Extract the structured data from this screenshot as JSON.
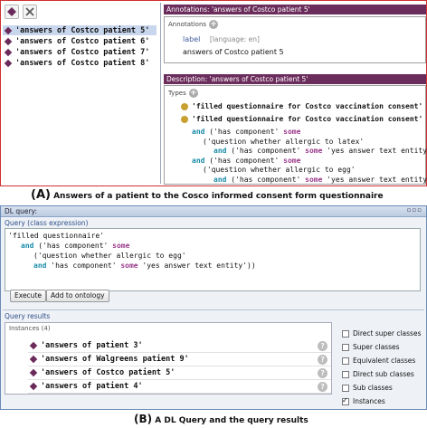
{
  "panel_a": {
    "toolbar": {
      "add_icon": "add-individual-icon",
      "delete_icon": "delete-individual-icon"
    },
    "instances": [
      {
        "label": "'answers of Costco patient 5'",
        "selected": true
      },
      {
        "label": "'answers of Costco patient 6'",
        "selected": false
      },
      {
        "label": "'answers of Costco patient 7'",
        "selected": false
      },
      {
        "label": "'answers of Costco patient 8'",
        "selected": false
      }
    ],
    "annotations": {
      "title": "Annotations: 'answers of Costco patient 5'",
      "header": "Annotations",
      "label_key": "label",
      "language": "[language: en]",
      "label_value": "answers of Costco patient 5"
    },
    "description": {
      "title": "Description: 'answers of Costco patient 5'",
      "types_header": "Types",
      "type1": "'filled questionnaire for Costco vaccination consent'",
      "type2": "'filled questionnaire for Costco vaccination consent'",
      "lines": [
        {
          "and": "and",
          "pre": " ('has component' ",
          "some": "some",
          "post": ""
        },
        {
          "and": "",
          "pre": "('question whether allergic to latex'",
          "some": "",
          "post": ""
        },
        {
          "and": "and",
          "pre": " ('has component' ",
          "some": "some",
          "post": " 'yes answer text entity')))"
        },
        {
          "and": "and",
          "pre": " ('has component' ",
          "some": "some",
          "post": ""
        },
        {
          "and": "",
          "pre": "('question whether allergic to egg'",
          "some": "",
          "post": ""
        },
        {
          "and": "and",
          "pre": " ('has component' ",
          "some": "some",
          "post": " 'yes answer text entity')))"
        }
      ]
    },
    "caption_letter": "(A)",
    "caption_text": "Answers of a patient to the Cosco informed consent form questionnaire"
  },
  "panel_b": {
    "window_title": "DL query:",
    "query_header": "Query (class expression)",
    "query_lines": [
      {
        "and": "",
        "pre": "'filled questionnaire'",
        "some": "",
        "post": ""
      },
      {
        "and": "and",
        "pre": " ('has component' ",
        "some": "some",
        "post": ""
      },
      {
        "and": "",
        "pre": "('question whether allergic to egg'",
        "some": "",
        "post": ""
      },
      {
        "and": "and",
        "pre": " 'has component' ",
        "some": "some",
        "post": " 'yes answer text entity'))"
      }
    ],
    "execute_label": "Execute",
    "add_label": "Add to ontology",
    "results_header": "Query results",
    "instances_header": "Instances (4)",
    "results": [
      "'answers of patient 3'",
      "'answers of Walgreens patient 9'",
      "'answers of Costco patient 5'",
      "'answers of patient 4'"
    ],
    "options": [
      {
        "label": "Direct super classes",
        "checked": false
      },
      {
        "label": "Super classes",
        "checked": false
      },
      {
        "label": "Equivalent classes",
        "checked": false
      },
      {
        "label": "Direct sub classes",
        "checked": false
      },
      {
        "label": "Sub classes",
        "checked": false
      },
      {
        "label": "Instances",
        "checked": true
      }
    ],
    "caption_letter": "(B)",
    "caption_text": "A DL Query and the query results"
  }
}
